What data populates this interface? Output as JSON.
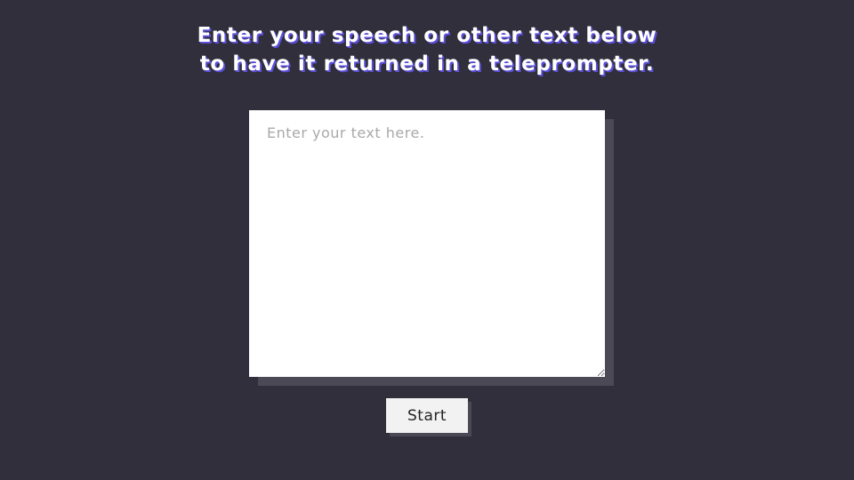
{
  "heading": {
    "line1": "Enter your speech or other text below",
    "line2": "to have it returned in a teleprompter."
  },
  "input": {
    "placeholder": "Enter your text here.",
    "value": ""
  },
  "start_button": {
    "label": "Start"
  },
  "colors": {
    "background": "#302f3b",
    "heading_text": "#ffffff",
    "heading_shadow": "#5a4fd8",
    "panel_shadow": "#4a4955",
    "textarea_bg": "#ffffff",
    "button_bg": "#f2f2f2"
  }
}
